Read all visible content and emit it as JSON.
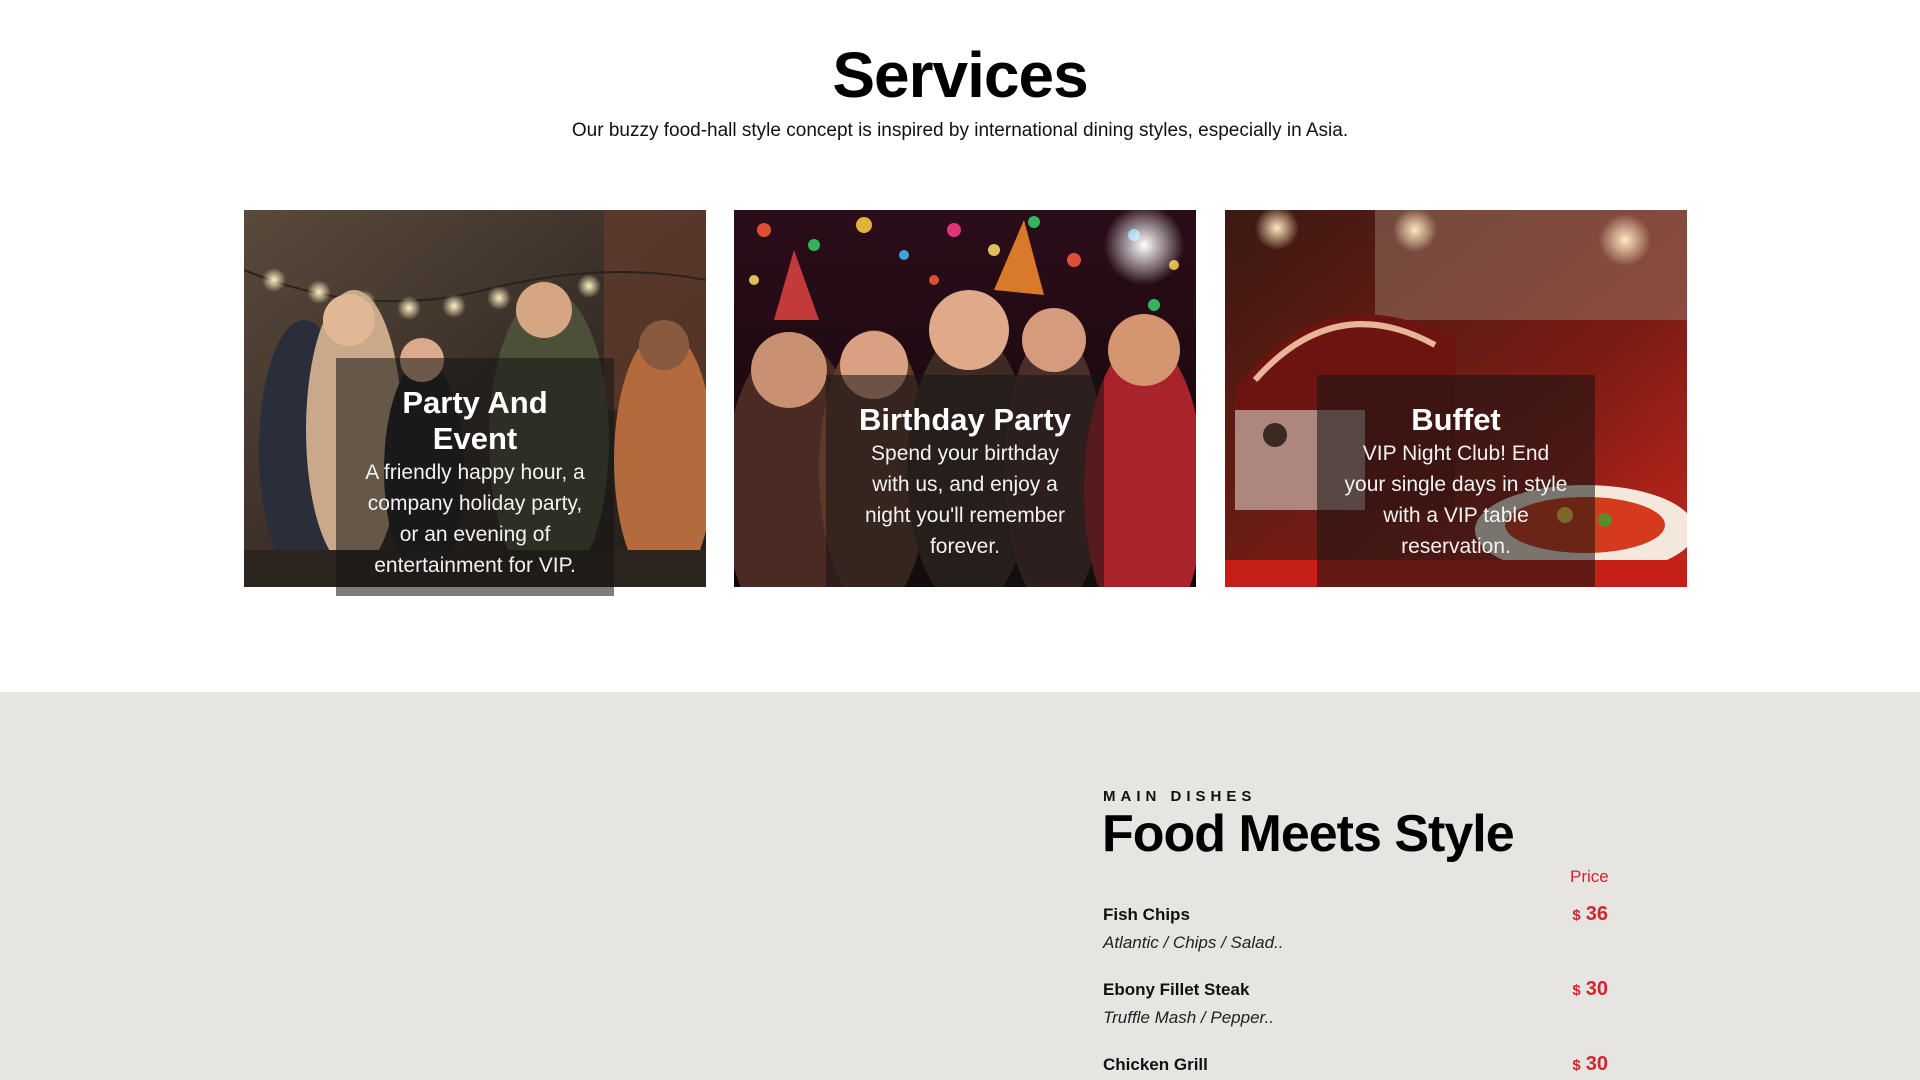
{
  "services": {
    "title": "Services",
    "subtitle": "Our buzzy food-hall style concept is inspired by international dining styles, especially in Asia.",
    "cards": [
      {
        "title_lines": [
          "Party And",
          "Event"
        ],
        "desc_lines": [
          "A friendly happy hour, a",
          "company holiday party,",
          "or an evening of",
          "entertainment for VIP."
        ]
      },
      {
        "title_lines": [
          "Birthday Party"
        ],
        "desc_lines": [
          "Spend your birthday",
          "with us, and enjoy a",
          "night you'll remember",
          "forever."
        ]
      },
      {
        "title_lines": [
          "Buffet"
        ],
        "desc_lines": [
          "VIP Night Club! End",
          "your single days in style",
          "with a VIP table",
          "reservation."
        ]
      }
    ]
  },
  "menu": {
    "kicker": "MAIN DISHES",
    "title": "Food Meets Style",
    "price_header": "Price",
    "currency": "$",
    "dishes": [
      {
        "name": "Fish Chips",
        "desc": "Atlantic / Chips / Salad..",
        "price": "36"
      },
      {
        "name": "Ebony Fillet Steak",
        "desc": "Truffle Mash / Pepper..",
        "price": "30"
      },
      {
        "name": "Chicken Grill",
        "desc": "",
        "price": "30"
      }
    ]
  },
  "colors": {
    "accent": "#d3262f",
    "menu_background": "#e6e5e2",
    "overlay": "#141414"
  }
}
